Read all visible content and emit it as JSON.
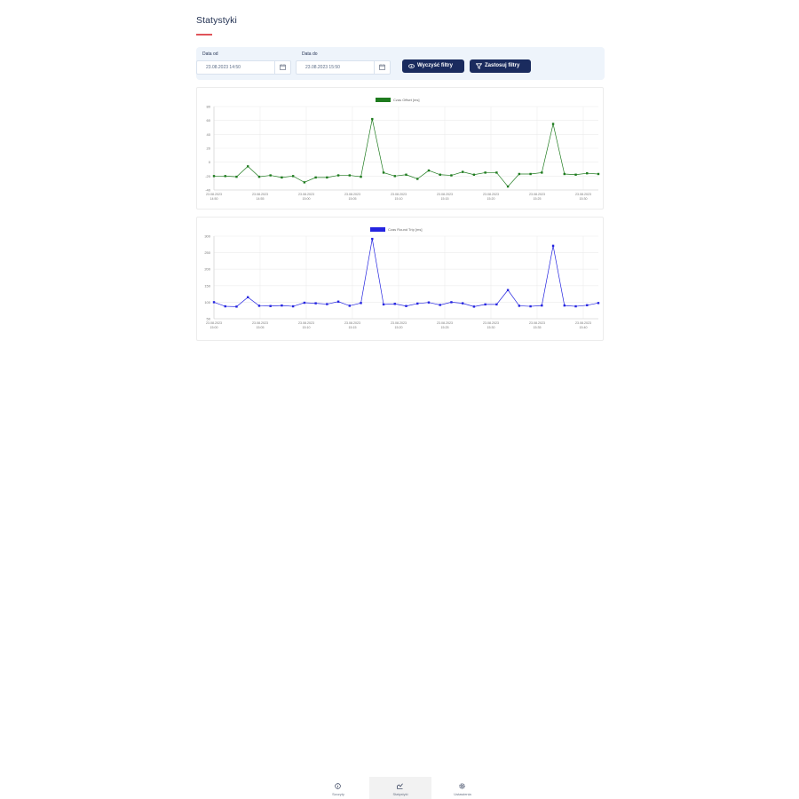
{
  "page": {
    "title": "Statystyki"
  },
  "filters": {
    "date_from": {
      "label": "Data od",
      "value": "23.08.2023 14:50"
    },
    "date_to": {
      "label": "Data do",
      "value": "23.08.2023 15:50"
    },
    "clear_label": "Wyczyść filtry",
    "apply_label": "Zastosuj filtry"
  },
  "charts": {
    "top": {
      "legend": "Czas Offset [ms]",
      "color": "#1e7b1e",
      "yticks": [
        "80",
        "60",
        "40",
        "20",
        "0",
        "-20",
        "-40"
      ],
      "xticks": [
        [
          "23.08.2023",
          "14:50"
        ],
        [
          "23.08.2023",
          "14:55"
        ],
        [
          "23.08.2023",
          "15:00"
        ],
        [
          "23.08.2023",
          "15:05"
        ],
        [
          "23.08.2023",
          "15:10"
        ],
        [
          "23.08.2023",
          "15:15"
        ],
        [
          "23.08.2023",
          "15:20"
        ],
        [
          "23.08.2023",
          "15:25"
        ],
        [
          "23.08.2023",
          "15:30"
        ]
      ]
    },
    "bottom": {
      "legend": "Czas Round Trip [ms]",
      "color": "#2424e0",
      "yticks": [
        "300",
        "250",
        "200",
        "150",
        "100",
        "50"
      ],
      "xticks": [
        [
          "23.08.2023",
          "15:00"
        ],
        [
          "23.08.2023",
          "15:05"
        ],
        [
          "23.08.2023",
          "15:10"
        ],
        [
          "23.08.2023",
          "15:15"
        ],
        [
          "23.08.2023",
          "15:20"
        ],
        [
          "23.08.2023",
          "15:25"
        ],
        [
          "23.08.2023",
          "15:30"
        ],
        [
          "23.08.2023",
          "15:35"
        ],
        [
          "23.08.2023",
          "15:40"
        ]
      ]
    }
  },
  "chart_data": [
    {
      "type": "line",
      "ylim": [
        -40,
        80
      ],
      "series": [
        {
          "name": "Czas Offset [ms]",
          "values": [
            -20,
            -20,
            -21,
            -6,
            -21,
            -19,
            -22,
            -20,
            -29,
            -22,
            -22,
            -19,
            -19,
            -21,
            62,
            -15,
            -20,
            -18,
            -24,
            -12,
            -18,
            -19,
            -14,
            -18,
            -15,
            -15,
            -35,
            -17,
            -17,
            -15,
            55,
            -17,
            -18,
            -16,
            -17
          ]
        }
      ]
    },
    {
      "type": "line",
      "ylim": [
        0,
        300
      ],
      "series": [
        {
          "name": "Czas Round Trip [ms]",
          "values": [
            60,
            45,
            44,
            78,
            47,
            46,
            48,
            45,
            58,
            56,
            53,
            62,
            47,
            57,
            290,
            52,
            54,
            46,
            55,
            59,
            50,
            60,
            56,
            44,
            52,
            52,
            104,
            47,
            45,
            48,
            265,
            48,
            45,
            49,
            57
          ]
        }
      ]
    }
  ],
  "nav": {
    "items": [
      {
        "label": "Szczyty",
        "icon": "info-icon"
      },
      {
        "label": "Statystyki",
        "icon": "stats-icon"
      },
      {
        "label": "Ustawienia",
        "icon": "gear-icon"
      }
    ]
  }
}
